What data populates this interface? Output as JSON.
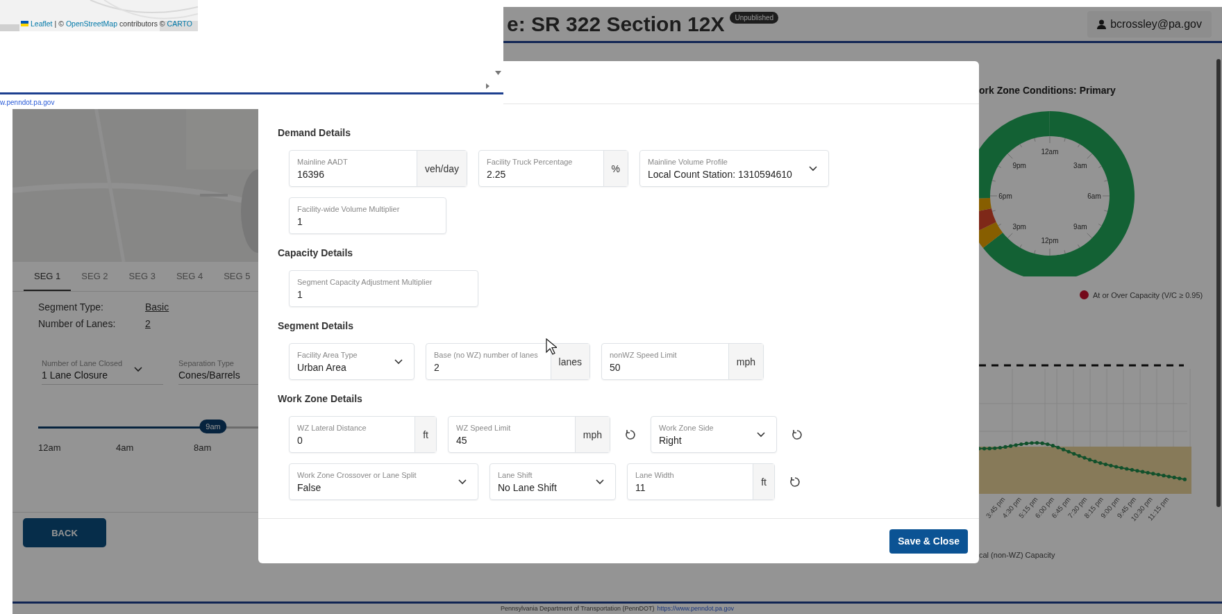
{
  "popup": {
    "attribution": [
      {
        "text": "Leaflet",
        "link": true
      },
      {
        "text": "| ©",
        "link": false
      },
      {
        "text": "OpenStreetMap",
        "link": true
      },
      {
        "text": "contributors ©",
        "link": false
      },
      {
        "text": "CARTO",
        "link": true
      }
    ],
    "link": "w.penndot.pa.gov"
  },
  "header": {
    "title": "e: SR 322 Section 12X",
    "badge": "Unpublished",
    "user": "bcrossley@pa.gov"
  },
  "left_panel": {
    "tabs": [
      {
        "label": "SEG 1",
        "selected": true
      },
      {
        "label": "SEG 2",
        "selected": false
      },
      {
        "label": "SEG 3",
        "selected": false
      },
      {
        "label": "SEG 4",
        "selected": false
      },
      {
        "label": "SEG 5",
        "selected": false
      }
    ],
    "info": [
      {
        "label": "Segment Type:",
        "value": "Basic"
      },
      {
        "label": "Number of Lanes:",
        "value": "2"
      }
    ],
    "selects": [
      {
        "label": "Number of Lane Closed",
        "value": "1 Lane Closure",
        "dropdown": true
      },
      {
        "label": "Separation Type",
        "value": "Cones/Barrels",
        "dropdown": false
      }
    ],
    "slider": {
      "thumb_label": "9am",
      "level": 0.375,
      "ticks": [
        "12am",
        "4am",
        "8am"
      ]
    },
    "back_button": "BACK"
  },
  "modal": {
    "sections": [
      {
        "title": "Demand Details",
        "rows": [
          [
            {
              "kind": "input",
              "label": "Mainline AADT",
              "value": "16396",
              "unit": "veh/day",
              "reset": false
            },
            {
              "kind": "input",
              "label": "Facility Truck Percentage",
              "value": "2.25",
              "unit": "%",
              "reset": false
            },
            {
              "kind": "select",
              "label": "Mainline Volume Profile",
              "value": "Local Count Station: 1310594610",
              "reset": false
            }
          ],
          [
            {
              "kind": "input",
              "label": "Facility-wide Volume Multiplier",
              "value": "1",
              "reset": false
            }
          ]
        ]
      },
      {
        "title": "Capacity Details",
        "rows": [
          [
            {
              "kind": "input",
              "label": "Segment Capacity Adjustment Multiplier",
              "value": "1",
              "reset": false
            }
          ]
        ]
      },
      {
        "title": "Segment Details",
        "rows": [
          [
            {
              "kind": "select",
              "label": "Facility Area Type",
              "value": "Urban Area",
              "reset": false
            },
            {
              "kind": "input",
              "label": "Base (no WZ) number of lanes",
              "value": "2",
              "unit": "lanes",
              "reset": false
            },
            {
              "kind": "input",
              "label": "nonWZ Speed Limit",
              "value": "50",
              "unit": "mph",
              "reset": false
            }
          ]
        ]
      },
      {
        "title": "Work Zone Details",
        "rows": [
          [
            {
              "kind": "input",
              "label": "WZ Lateral Distance",
              "value": "0",
              "unit": "ft",
              "reset": false
            },
            {
              "kind": "input",
              "label": "WZ Speed Limit",
              "value": "45",
              "unit": "mph",
              "reset": true
            },
            {
              "kind": "select",
              "label": "Work Zone Side",
              "value": "Right",
              "reset": true
            }
          ],
          [
            {
              "kind": "select",
              "label": "Work Zone Crossover or Lane Split",
              "value": "False",
              "reset": false
            },
            {
              "kind": "select",
              "label": "Lane Shift",
              "value": "No Lane Shift",
              "reset": false
            },
            {
              "kind": "input",
              "label": "Lane Width",
              "value": "11",
              "unit": "ft",
              "reset": true
            }
          ]
        ]
      }
    ],
    "save_button": "Save & Close"
  },
  "right_panel": {
    "title": "ork Zone Conditions: Primary",
    "clock_labels": [
      "12am",
      "3am",
      "6am",
      "9am",
      "12pm",
      "3pm",
      "6pm",
      "9pm"
    ],
    "legend": "At or Over Capacity (V/C ≥ 0.95)",
    "x_labels": [
      "3:45 pm",
      "4:30 pm",
      "5:15 pm",
      "6:00 pm",
      "6:45 pm",
      "7:30 pm",
      "8:15 pm",
      "9:00 pm",
      "9:45 pm",
      "10:30 pm",
      "11:15 pm"
    ],
    "line_legend": "cal (non-WZ) Capacity"
  },
  "footer": {
    "text": "Pennsylvania Department of Transportation (PennDOT)",
    "link": "https://www.penndot.pa.gov"
  }
}
